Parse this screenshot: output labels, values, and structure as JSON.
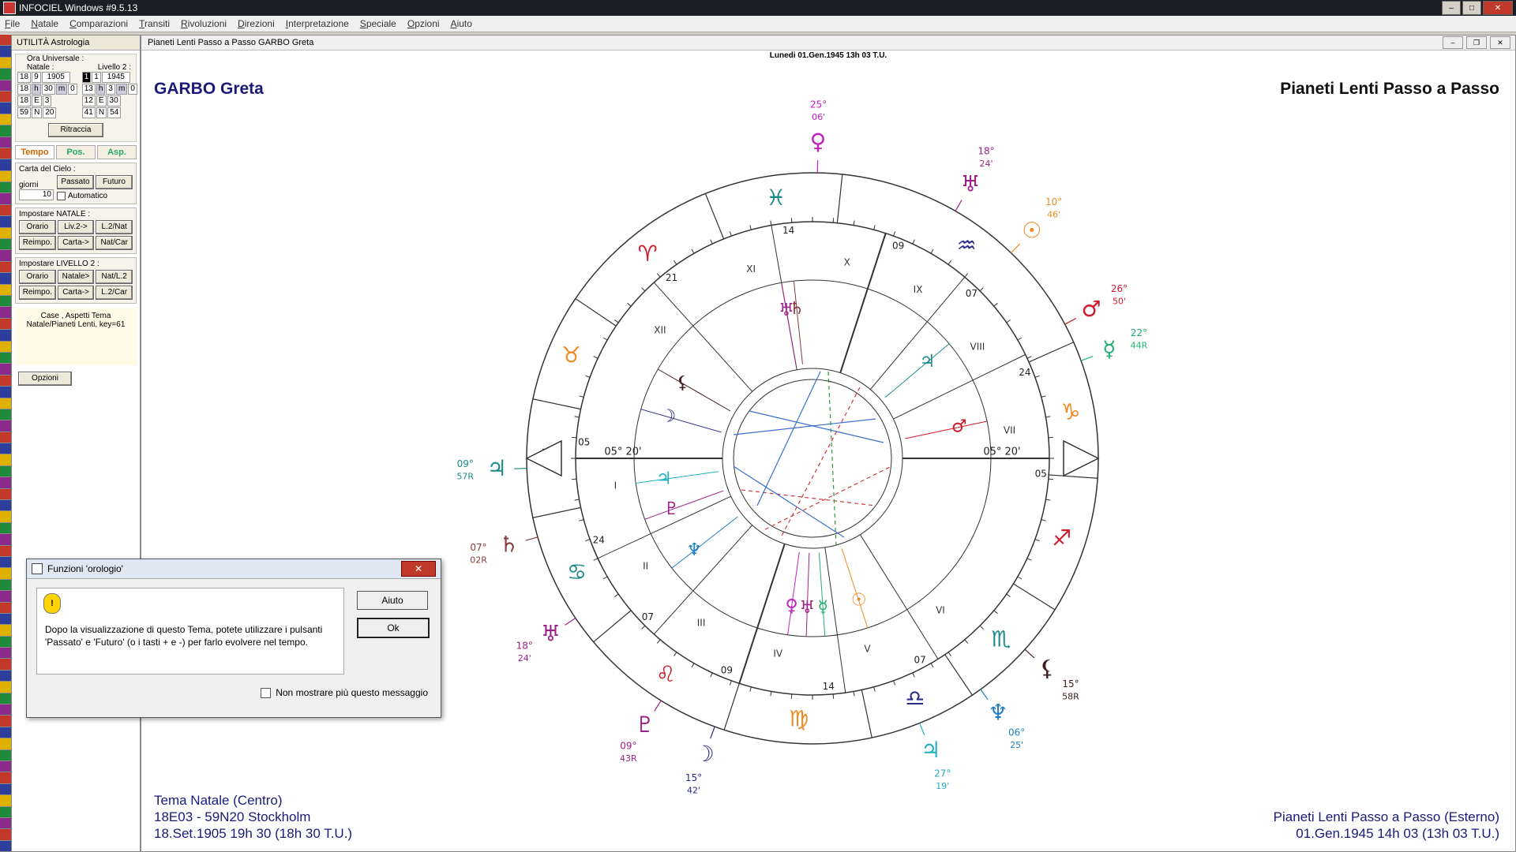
{
  "window": {
    "title": "INFOCIEL Windows #9.5.13"
  },
  "menu": [
    "File",
    "Natale",
    "Comparazioni",
    "Transiti",
    "Rivoluzioni",
    "Direzioni",
    "Interpretazione",
    "Speciale",
    "Opzioni",
    "Aiuto"
  ],
  "util": {
    "title": "UTILITÀ Astrologia",
    "ora_universale": "Ora Universale :",
    "natale_label": "Natale :",
    "livello_label": "Livello 2 :",
    "natale_rows": [
      [
        "18",
        "9",
        "1905"
      ],
      [
        "18",
        "h",
        "30",
        "m",
        "0"
      ],
      [
        "18",
        "E",
        "3",
        ""
      ],
      [
        "59",
        "N",
        "20",
        ""
      ]
    ],
    "livello_rows": [
      [
        "1",
        "1",
        "1945"
      ],
      [
        "13",
        "h",
        "3",
        "m",
        "0"
      ],
      [
        "12",
        "E",
        "30",
        ""
      ],
      [
        "41",
        "N",
        "54",
        ""
      ]
    ],
    "ritraccia": "Ritraccia",
    "tabs": [
      "Tempo",
      "Pos.",
      "Asp."
    ],
    "carta_cielo": "Carta del Cielo :",
    "giorni": "giorni",
    "giorni_val": "10",
    "passato": "Passato",
    "futuro": "Futuro",
    "automatico": "Automatico",
    "imp_natale": "Impostare NATALE :",
    "imp_natale_btns": [
      [
        "Orario",
        "Liv.2->",
        "L.2/Nat"
      ],
      [
        "Reimpo.",
        "Carta->",
        "Nat/Car"
      ]
    ],
    "imp_liv2": "Impostare LIVELLO 2 :",
    "imp_liv2_btns": [
      [
        "Orario",
        "Natale>",
        "Nat/L.2"
      ],
      [
        "Reimpo.",
        "Carta->",
        "L.2/Car"
      ]
    ],
    "info": "Case , Aspetti Tema Natale/Pianeti Lenti, key=61",
    "opzioni": "Opzioni"
  },
  "chart_window": {
    "title": "Pianeti Lenti Passo a Passo  GARBO Greta",
    "date_bar": "Lunedi 01.Gen.1945 13h 03 T.U.",
    "name": "GARBO Greta",
    "chart_title": "Pianeti Lenti Passo a Passo",
    "bottom_left": [
      "Tema Natale (Centro)",
      "18E03 - 59N20  Stockholm",
      "18.Set.1905 19h 30 (18h 30 T.U.)"
    ],
    "bottom_right": [
      "Pianeti Lenti Passo a Passo (Esterno)",
      "01.Gen.1945 14h 03 (13h 03 T.U.)"
    ],
    "asc_label": "05° 20'",
    "dsc_label": "05° 20'",
    "roman": [
      "I",
      "II",
      "III",
      "IV",
      "V",
      "VI",
      "VII",
      "VIII",
      "IX",
      "X",
      "XI",
      "XII"
    ],
    "cusps": [
      "05",
      "24",
      "07",
      "09",
      "14",
      "07",
      "05",
      "24",
      "07",
      "09",
      "14",
      "21"
    ],
    "outer_glyphs": [
      {
        "g": "♀",
        "t": "25°",
        "m": "06'",
        "c": "#c020c0"
      },
      {
        "g": "♅",
        "t": "18°",
        "m": "24'",
        "c": "#a0208a"
      },
      {
        "g": "☉",
        "t": "10°",
        "m": "46'",
        "c": "#f08a20"
      },
      {
        "g": "♂",
        "t": "26°",
        "m": "50'",
        "c": "#d01a2a"
      },
      {
        "g": "☿",
        "t": "22°",
        "m": "44R",
        "c": "#20b070"
      },
      {
        "g": "♃",
        "t": "09°",
        "m": "57R",
        "c": "#1a8a8a"
      },
      {
        "g": "♄",
        "t": "07°",
        "m": "02R",
        "c": "#8a3a3a"
      },
      {
        "g": "♅",
        "t": "18°",
        "m": "24'",
        "c": "#a0208a"
      },
      {
        "g": "♇",
        "t": "09°",
        "m": "43R",
        "c": "#a0208a"
      },
      {
        "g": "☽",
        "t": "15°",
        "m": "42'",
        "c": "#2a2a8a"
      },
      {
        "g": "♃",
        "t": "27°",
        "m": "19'",
        "c": "#20b0c0"
      },
      {
        "g": "♆",
        "t": "06°",
        "m": "25'",
        "c": "#2080c0"
      },
      {
        "g": "⚸",
        "t": "15°",
        "m": "58R",
        "c": "#402020"
      }
    ],
    "zodiac": [
      {
        "g": "♓",
        "c": "#1a8a8a"
      },
      {
        "g": "♈",
        "c": "#d01a2a"
      },
      {
        "g": "♉",
        "c": "#f08a20"
      },
      {
        "g": "♊",
        "c": "#2a2a8a"
      },
      {
        "g": "♋",
        "c": "#1a8a8a"
      },
      {
        "g": "♌",
        "c": "#d01a2a"
      },
      {
        "g": "♍",
        "c": "#f08a20"
      },
      {
        "g": "♎",
        "c": "#2a2a8a"
      },
      {
        "g": "♏",
        "c": "#1a8a8a"
      },
      {
        "g": "♐",
        "c": "#d01a2a"
      },
      {
        "g": "♑",
        "c": "#f08a20"
      },
      {
        "g": "♒",
        "c": "#2a2a8a"
      }
    ]
  },
  "dialog": {
    "title": "Funzioni 'orologio'",
    "close": "✕",
    "message": "Dopo la visualizzazione di questo Tema, potete utilizzare i pulsanti 'Passato' e 'Futuro' (o i tasti + e -) per farlo evolvere nel tempo.",
    "aiuto": "Aiuto",
    "ok": "Ok",
    "checkbox": "Non mostrare più questo messaggio"
  }
}
